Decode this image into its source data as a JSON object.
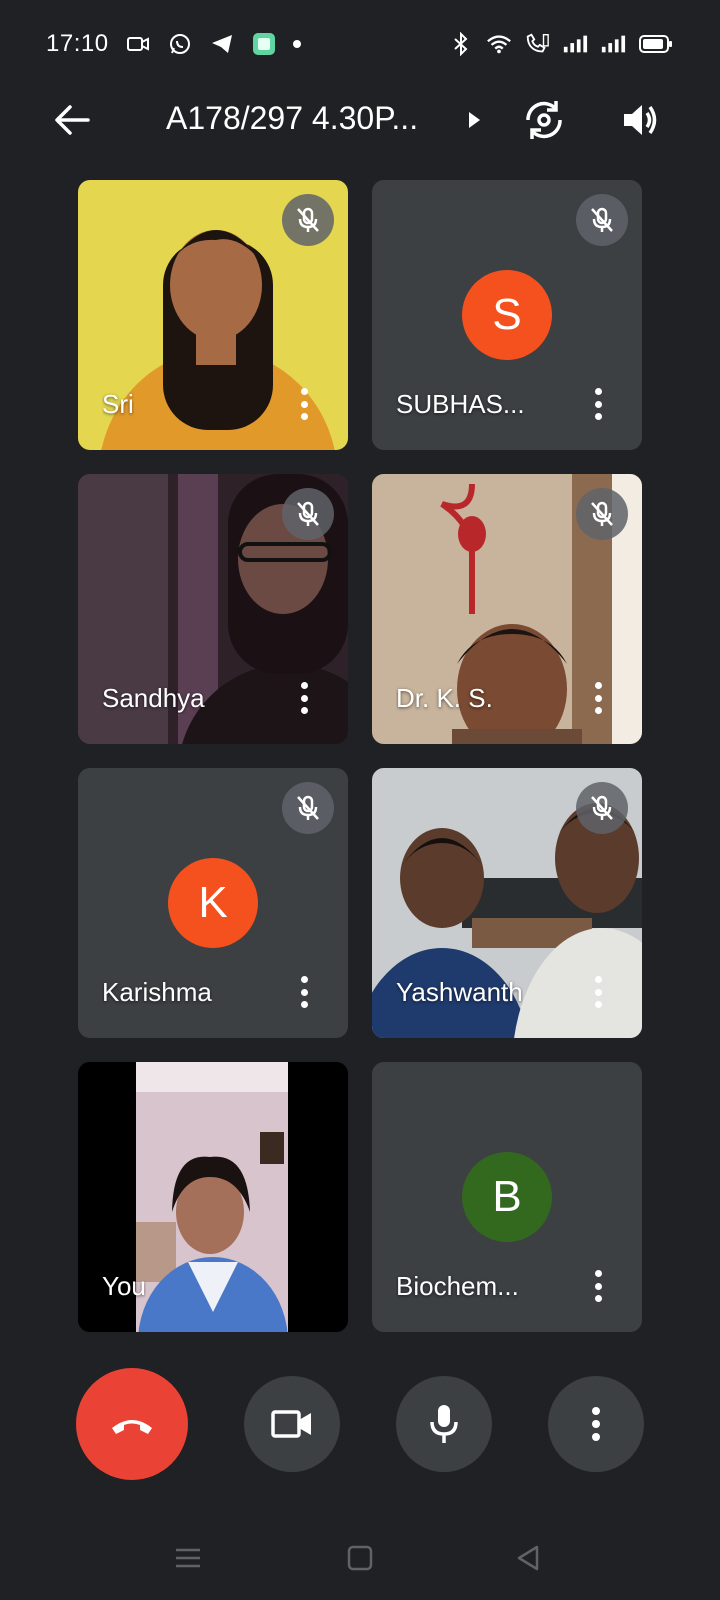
{
  "status_bar": {
    "time": "17:10",
    "left_icons": [
      "video-camera-icon",
      "whatsapp-icon",
      "telegram-icon",
      "app-icon",
      "dot-icon"
    ],
    "right_icons": [
      "bluetooth-icon",
      "wifi-icon",
      "volte-icon",
      "signal-icon",
      "signal-icon",
      "battery-icon"
    ]
  },
  "top_bar": {
    "title": "A178/297 4.30P..."
  },
  "participants": [
    {
      "name": "Sri",
      "type": "video",
      "muted": true,
      "bg": "#e7d94e"
    },
    {
      "name": "SUBHAS...",
      "type": "avatar",
      "initial": "S",
      "color": "#f4511e",
      "muted": true
    },
    {
      "name": "Sandhya",
      "type": "video",
      "muted": true,
      "bg": "#3a2e34"
    },
    {
      "name": "Dr. K. S.",
      "type": "video",
      "muted": true,
      "bg": "#c9b7a0"
    },
    {
      "name": "Karishma",
      "type": "avatar",
      "initial": "K",
      "color": "#f4511e",
      "muted": true
    },
    {
      "name": "Yashwanth",
      "type": "video",
      "muted": true,
      "bg": "#4a4f57"
    },
    {
      "name": "You",
      "type": "video",
      "muted": false,
      "bg": "#000000"
    },
    {
      "name": "Biochem...",
      "type": "avatar",
      "initial": "B",
      "color": "#33691e",
      "muted": false
    }
  ],
  "controls": {
    "end_call_color": "#ea4335",
    "button_bg": "#3c4043"
  }
}
